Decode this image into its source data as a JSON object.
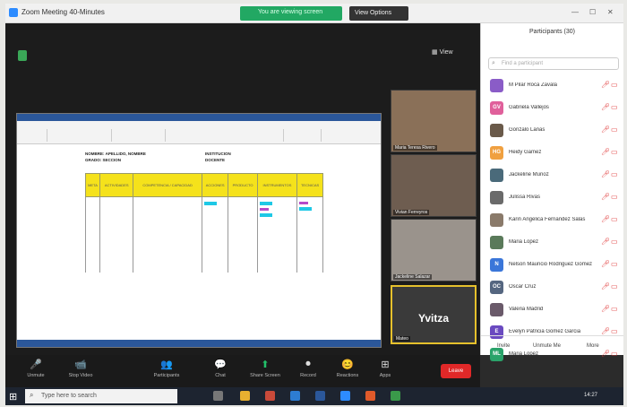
{
  "window": {
    "title": "Zoom Meeting 40-Minutes",
    "view_label": "View",
    "share_banner": "You are viewing screen",
    "options_label": "View Options"
  },
  "shared_screen": {
    "header_left_1": "NOMBRE: APELLIDO, NOMBRE",
    "header_left_2": "GRADO: SECCION",
    "header_right_1": "INSTITUCION",
    "header_right_2": "DOCENTE",
    "columns": [
      "META",
      "ACTIVIDADES",
      "COMPETENCIA / CAPACIDAD",
      "ACCIONES",
      "PRODUCTO",
      "INSTRUMENTOS",
      "TECNICAS"
    ]
  },
  "video_tiles": [
    {
      "name": "Maria Teresa Rivero"
    },
    {
      "name": "Vivian Ferreyros"
    },
    {
      "name": "Jackeline Salazar"
    },
    {
      "name": "Mateo",
      "big_label": "Yvitza"
    }
  ],
  "participants": {
    "header": "Participants (30)",
    "search_placeholder": "Find a participant",
    "items": [
      {
        "initials": "",
        "name": "M Pilar Roca Zavala",
        "color": "#8a5cc7"
      },
      {
        "initials": "GV",
        "name": "Gabriela Vallejos",
        "color": "#e0609b"
      },
      {
        "initials": "",
        "name": "Gonzalo Lanas",
        "color": "#6a5a4a"
      },
      {
        "initials": "HG",
        "name": "Heidy Gamez",
        "color": "#f0a040"
      },
      {
        "initials": "",
        "name": "Jackeline Muñoz",
        "color": "#4a6a7a"
      },
      {
        "initials": "",
        "name": "Julissa Rivas",
        "color": "#6a6a6a"
      },
      {
        "initials": "",
        "name": "Karin Angelica Fernandez Salas",
        "color": "#8a7a6a"
      },
      {
        "initials": "",
        "name": "Maria Lopez",
        "color": "#5a7a5a"
      },
      {
        "initials": "N",
        "name": "Nelson Mauricio Rodriguez Gomez",
        "color": "#3a76d9"
      },
      {
        "initials": "OC",
        "name": "Oscar Cruz",
        "color": "#556680"
      },
      {
        "initials": "",
        "name": "Valeria Madrid",
        "color": "#6a5a6a"
      },
      {
        "initials": "E",
        "name": "Evelyn Patricia Gomez Garcia",
        "color": "#6a4ac0"
      },
      {
        "initials": "ML",
        "name": "Maria Lopez",
        "color": "#2aa36a"
      }
    ],
    "footer_invite": "Invite",
    "footer_unmute": "Unmute Me",
    "footer_more": "More"
  },
  "toolbar": [
    {
      "icon": "🎤",
      "label": "Unmute"
    },
    {
      "icon": "📹",
      "label": "Stop Video"
    },
    {
      "icon": "👥",
      "label": "Participants"
    },
    {
      "icon": "💬",
      "label": "Chat"
    },
    {
      "icon": "⬆",
      "label": "Share Screen"
    },
    {
      "icon": "⏺",
      "label": "Record"
    },
    {
      "icon": "😊",
      "label": "Reactions"
    },
    {
      "icon": "⊞",
      "label": "Apps"
    }
  ],
  "leave_label": "Leave",
  "taskbar": {
    "search_placeholder": "Type here to search",
    "time": "14:27"
  }
}
